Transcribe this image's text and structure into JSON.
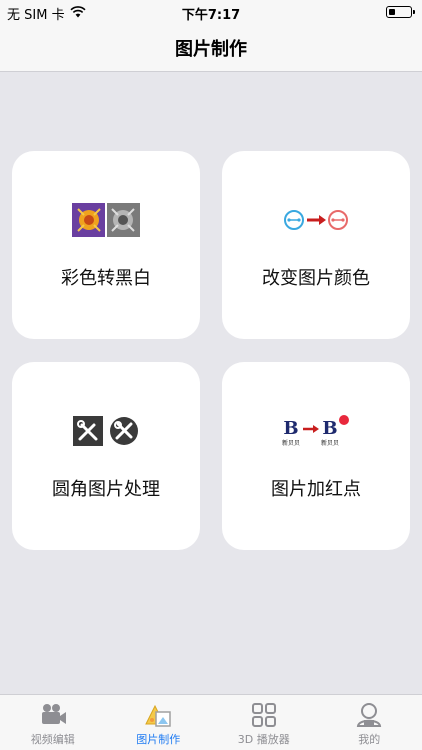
{
  "status_bar": {
    "carrier": "无 SIM 卡",
    "wifi_icon": "wifi-icon",
    "time": "下午7:17",
    "battery_icon": "battery-icon",
    "battery_level": 0.3
  },
  "nav": {
    "title": "图片制作"
  },
  "cards": [
    {
      "label": "彩色转黑白",
      "icon": "color-to-grayscale-icon"
    },
    {
      "label": "改变图片颜色",
      "icon": "change-color-icon"
    },
    {
      "label": "圆角图片处理",
      "icon": "rounded-corner-icon"
    },
    {
      "label": "图片加红点",
      "icon": "red-dot-badge-icon",
      "icon_text": [
        "B",
        "B",
        "新贝贝",
        "新贝贝"
      ]
    }
  ],
  "tabs": [
    {
      "label": "视频编辑",
      "icon": "video-camera-icon",
      "active": false
    },
    {
      "label": "图片制作",
      "icon": "image-make-icon",
      "active": true
    },
    {
      "label": "3D 播放器",
      "icon": "grid-icon",
      "active": false
    },
    {
      "label": "我的",
      "icon": "user-icon",
      "active": false
    }
  ],
  "colors": {
    "accent": "#1f7bf2",
    "background": "#e6e6eb",
    "card": "#ffffff",
    "red_dot": "#e8283c"
  }
}
